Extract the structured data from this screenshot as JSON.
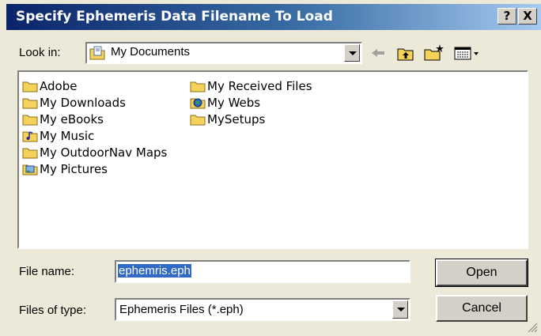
{
  "window": {
    "title": "Specify Ephemeris Data Filename To Load",
    "help_button": "?",
    "close_button": "X"
  },
  "look_in": {
    "label": "Look in:",
    "value": "My Documents",
    "icon": "my-documents-icon"
  },
  "toolbar": {
    "back_icon": "back-arrow-icon",
    "up_icon": "up-folder-icon",
    "new_folder_icon": "new-folder-icon",
    "view_menu_icon": "view-menu-icon"
  },
  "files": {
    "column1": [
      {
        "name": "Adobe",
        "icon": "folder-icon"
      },
      {
        "name": "My Downloads",
        "icon": "folder-icon"
      },
      {
        "name": "My eBooks",
        "icon": "folder-icon"
      },
      {
        "name": "My Music",
        "icon": "music-folder-icon"
      },
      {
        "name": "My OutdoorNav Maps",
        "icon": "folder-icon"
      },
      {
        "name": "My Pictures",
        "icon": "pictures-folder-icon"
      }
    ],
    "column2": [
      {
        "name": "My Received Files",
        "icon": "folder-icon"
      },
      {
        "name": "My Webs",
        "icon": "webs-folder-icon"
      },
      {
        "name": "MySetups",
        "icon": "folder-icon"
      }
    ]
  },
  "file_name": {
    "label": "File name:",
    "value": "ephemris.eph"
  },
  "file_type": {
    "label": "Files of type:",
    "value": "Ephemeris Files (*.eph)"
  },
  "buttons": {
    "open": "Open",
    "cancel": "Cancel"
  },
  "colors": {
    "face": "#ece9d8",
    "title_start": "#0a246a",
    "title_end": "#a6caf0",
    "selection": "#316ac5",
    "folder": "#f5d35a"
  }
}
